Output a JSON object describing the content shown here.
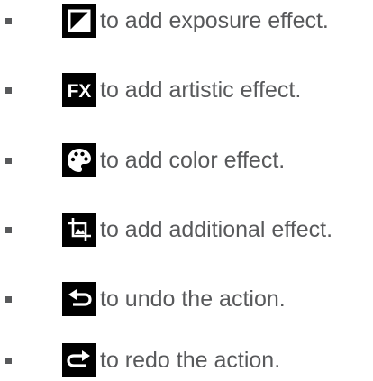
{
  "colors": {
    "text": "#58595b",
    "icon_background": "#000000",
    "icon_foreground": "#ffffff",
    "bullet": "#58595b"
  },
  "items": [
    {
      "icon": "exposure-icon",
      "text": "to add exposure effect."
    },
    {
      "icon": "fx-icon",
      "icon_label": "FX",
      "text": "to add artistic effect."
    },
    {
      "icon": "palette-icon",
      "text": "to add color effect."
    },
    {
      "icon": "crop-icon",
      "text": "to add additional effect."
    },
    {
      "icon": "undo-icon",
      "text": "to undo the action."
    },
    {
      "icon": "redo-icon",
      "text": "to redo the action."
    }
  ]
}
